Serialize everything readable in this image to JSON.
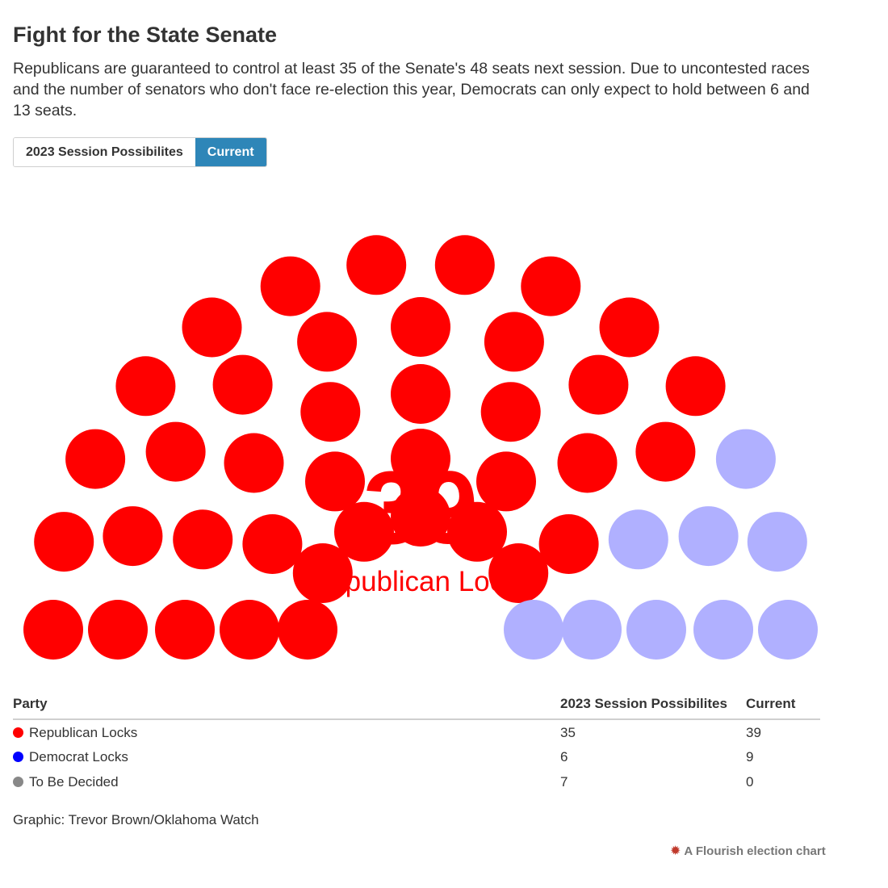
{
  "header": {
    "title": "Fight for the State Senate",
    "subtitle": "Republicans are guaranteed to control at least 35 of the Senate's 48 seats next session. Due to uncontested races and the number of senators who don't face re-election this year, Democrats can only expect to hold between 6 and 13 seats."
  },
  "toggle": {
    "options": [
      "2023 Session Possibilites",
      "Current"
    ],
    "active": "Current",
    "active_color": "#2e86b8"
  },
  "chart_data": {
    "type": "parliament",
    "total_seats": 48,
    "view": "Current",
    "headline_value": "39",
    "headline_label": "Republican Locks",
    "headline_color": "#ff0000",
    "parties": [
      {
        "name": "Republican Locks",
        "color": "#ff0000",
        "seat_color": "#ff0000",
        "values": {
          "2023 Session Possibilites": 35,
          "Current": 39
        }
      },
      {
        "name": "Democrat Locks",
        "color": "#0000ff",
        "seat_color": "#b0b0ff",
        "values": {
          "2023 Session Possibilites": 6,
          "Current": 9
        }
      },
      {
        "name": "To Be Decided",
        "color": "#888888",
        "seat_color": "#888888",
        "values": {
          "2023 Session Possibilites": 7,
          "Current": 0
        }
      }
    ]
  },
  "table": {
    "headers": [
      "Party",
      "2023 Session Possibilites",
      "Current"
    ],
    "rows": [
      {
        "party": "Republican Locks",
        "a": "35",
        "b": "39",
        "color": "#ff0000"
      },
      {
        "party": "Democrat Locks",
        "a": "6",
        "b": "9",
        "color": "#0000ff"
      },
      {
        "party": "To Be Decided",
        "a": "7",
        "b": "0",
        "color": "#888888"
      }
    ]
  },
  "footer": {
    "credit": "Graphic: Trevor Brown/Oklahoma Watch",
    "branding": "A Flourish election chart",
    "branding_icon": "flourish-burst-icon"
  }
}
